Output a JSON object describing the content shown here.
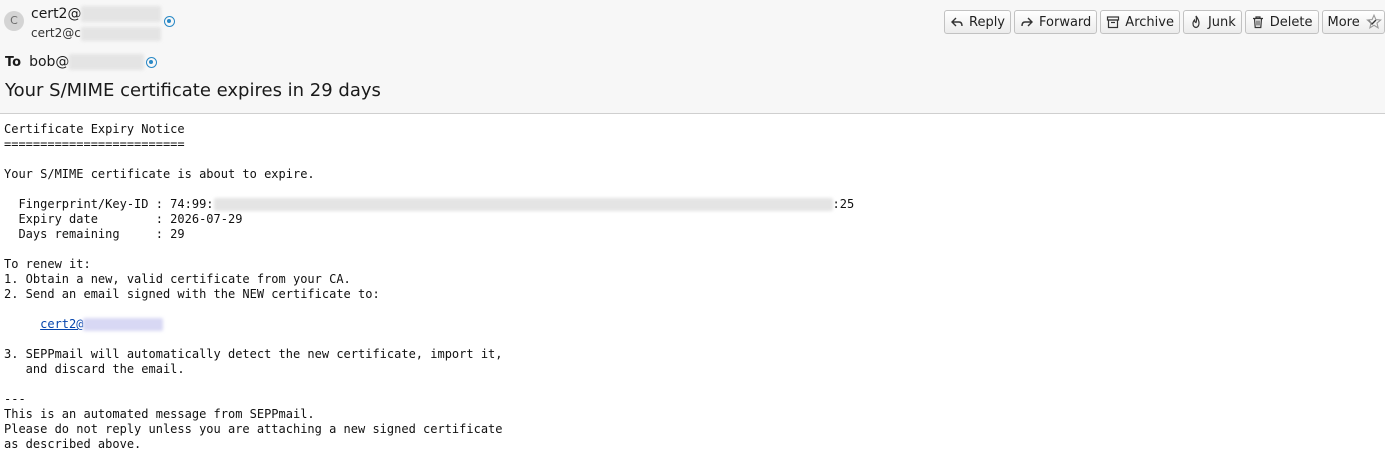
{
  "sender": {
    "avatar_letter": "C",
    "name_prefix": "cert2@",
    "email_prefix": "cert2@c"
  },
  "recipient": {
    "label": "To",
    "name_prefix": "bob@"
  },
  "subject": "Your S/MIME certificate expires in 29 days",
  "toolbar": {
    "reply": "Reply",
    "forward": "Forward",
    "archive": "Archive",
    "junk": "Junk",
    "delete": "Delete",
    "more": "More"
  },
  "body": {
    "l1": "Certificate Expiry Notice",
    "l2": "=========================",
    "l3": "Your S/MIME certificate is about to expire.",
    "fp_prefix": "  Fingerprint/Key-ID : 74:99:",
    "fp_suffix": ":25",
    "expiry": "  Expiry date        : 2026-07-29",
    "days": "  Days remaining     : 29",
    "renew": "To renew it:",
    "step1": "1. Obtain a new, valid certificate from your CA.",
    "step2": "2. Send an email signed with the NEW certificate to:",
    "link_prefix": "cert2@",
    "step3a": "3. SEPPmail will automatically detect the new certificate, import it,",
    "step3b": "   and discard the email.",
    "sep": "---",
    "f1": "This is an automated message from SEPPmail.",
    "f2": "Please do not reply unless you are attaching a new signed certificate",
    "f3": "as described above."
  }
}
